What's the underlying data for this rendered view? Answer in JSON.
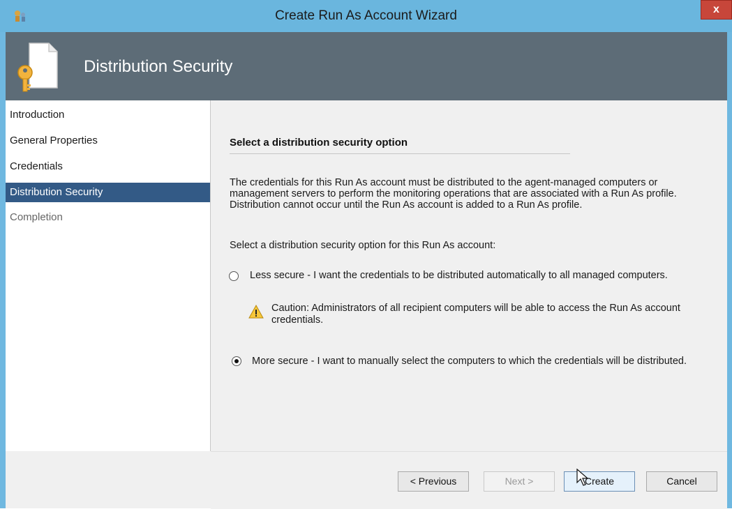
{
  "window": {
    "title": "Create Run As Account Wizard",
    "close_glyph": "x"
  },
  "banner": {
    "title": "Distribution Security",
    "icon": "document-key-icon"
  },
  "sidebar": {
    "items": [
      {
        "label": "Introduction",
        "state": "normal"
      },
      {
        "label": "General Properties",
        "state": "normal"
      },
      {
        "label": "Credentials",
        "state": "normal"
      },
      {
        "label": "Distribution Security",
        "state": "active"
      },
      {
        "label": "Completion",
        "state": "dim"
      }
    ]
  },
  "content": {
    "section_title": "Select a distribution security option",
    "description": "The credentials for this Run As account must be distributed to the agent-managed computers or management servers to perform the monitoring operations that are associated with a Run As profile. Distribution cannot occur until the Run As account is added to a Run As profile.",
    "prompt": "Select a distribution security option for this Run As account:",
    "options": [
      {
        "label": "Less secure - I want the credentials to be distributed automatically to all managed computers.",
        "selected": false
      },
      {
        "label": "More secure - I want to manually select the computers to which the credentials will be distributed.",
        "selected": true
      }
    ],
    "caution": "Caution: Administrators of all recipient computers will be able to access the Run As account credentials."
  },
  "footer": {
    "previous": "< Previous",
    "next": "Next >",
    "create": "Create",
    "cancel": "Cancel"
  },
  "colors": {
    "titlebar": "#6ab6de",
    "banner": "#5d6c77",
    "sidebar_active": "#335a86",
    "close": "#c7463a"
  }
}
